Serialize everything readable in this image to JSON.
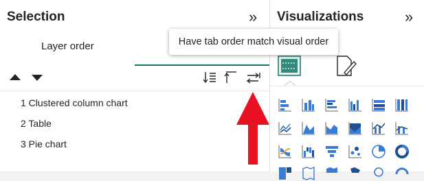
{
  "selection_pane": {
    "title": "Selection",
    "collapse_glyph": "»",
    "tab_label": "Layer order",
    "layers": [
      "1 Clustered column chart",
      "2 Table",
      "3 Pie chart"
    ]
  },
  "tooltip": {
    "text": "Have tab order match visual order"
  },
  "viz_pane": {
    "title": "Visualizations",
    "collapse_glyph": "»"
  },
  "colors": {
    "accent": "#117865",
    "arrow": "#e81123",
    "icon_blue": "#3a7bd5"
  }
}
